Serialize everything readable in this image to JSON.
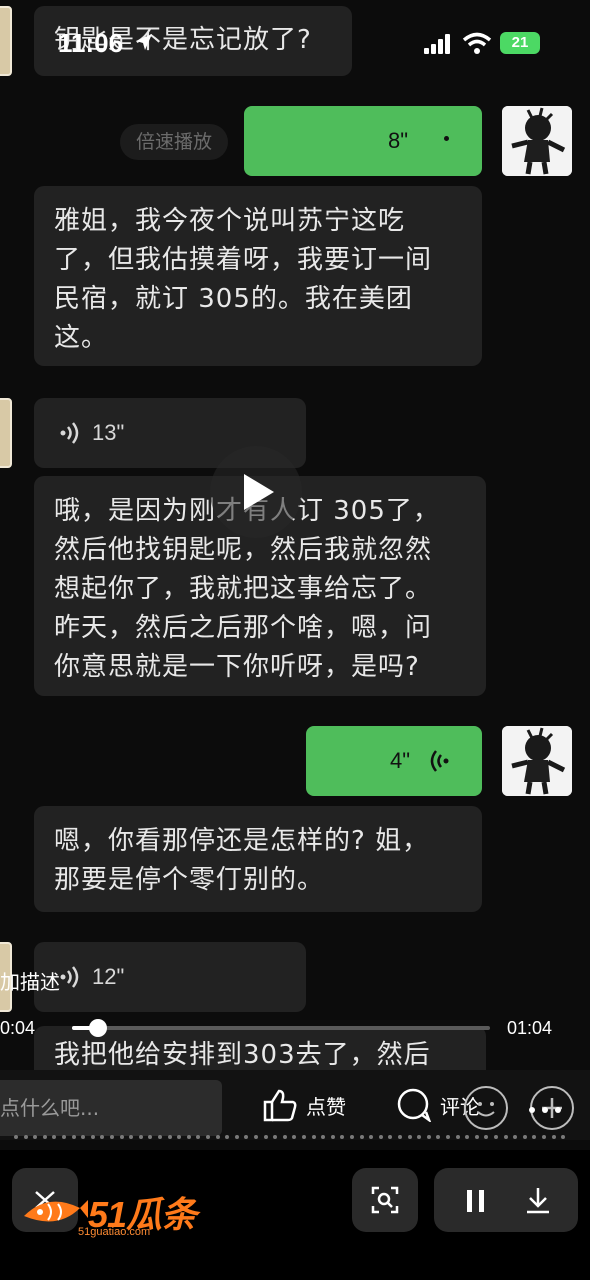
{
  "status_bar": {
    "time": "11:06",
    "battery": "21"
  },
  "chat": {
    "top_partial_message": "钥匙是不是忘记放了?",
    "voice_out_1": {
      "duration": "8\""
    },
    "speed_label": "倍速播放",
    "message_1": [
      "雅姐，我今夜个说叫苏宁这吃",
      "了，但我估摸着呀，我要订一间",
      "民宿，就订 305的。我在美团",
      "这。"
    ],
    "voice_in_1": {
      "duration": "13\""
    },
    "message_2": [
      "哦，是因为刚才有人订 305了，",
      "然后他找钥匙呢，然后我就忽然",
      "想起你了，我就把这事给忘了。",
      "昨天，然后之后那个啥，嗯，问",
      "你意思就是一下你听呀，是吗?"
    ],
    "voice_out_2": {
      "duration": "4\""
    },
    "message_3": [
      "嗯，你看那停还是怎样的? 姐，",
      "那要是停个零仃别的。"
    ],
    "voice_in_2": {
      "duration": "12\""
    },
    "message_4_partial": "我把他给安排到303去了，然后"
  },
  "overlay": {
    "description_snippet": "加描述"
  },
  "player": {
    "current_time": "0:04",
    "total_time": "01:04",
    "progress_fraction": 0.0625
  },
  "action_bar": {
    "comment_placeholder": "点什么吧...",
    "like_label": "点赞",
    "comment_label": "评论"
  },
  "brand": {
    "logo_text": "51瓜条",
    "logo_domain": "51guatiao.com",
    "accent": "#ff7a1a"
  },
  "colors": {
    "bubble_in": "#222222",
    "bubble_out": "#4fbd5b",
    "background": "#0c0c0c"
  }
}
